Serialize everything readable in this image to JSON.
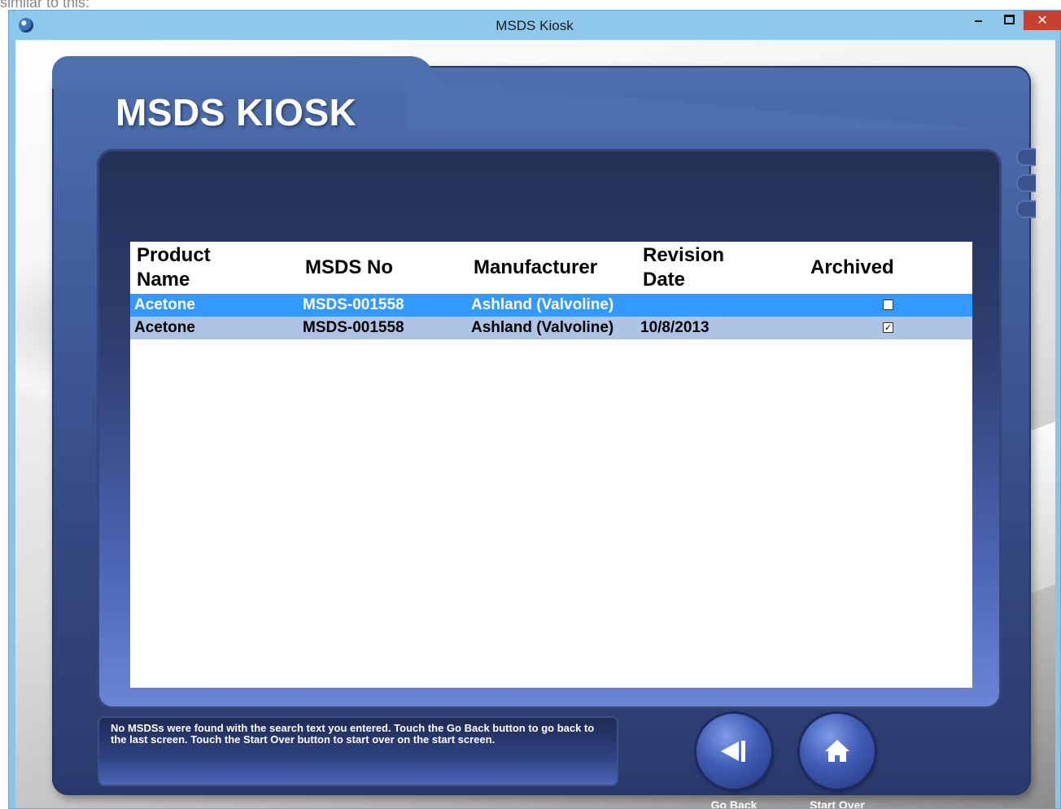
{
  "page_caption": "similar to this:",
  "window": {
    "title": "MSDS Kiosk"
  },
  "brand": "MSDS KIOSK",
  "table": {
    "columns": [
      "Product Name",
      "MSDS No",
      "Manufacturer",
      "Revision Date",
      "Archived"
    ],
    "rows": [
      {
        "product": "Acetone",
        "msds_no": "MSDS-001558",
        "manufacturer": "Ashland (Valvoline)",
        "revision_date": "",
        "archived": false,
        "selected": true
      },
      {
        "product": "Acetone",
        "msds_no": "MSDS-001558",
        "manufacturer": "Ashland (Valvoline)",
        "revision_date": "10/8/2013",
        "archived": true,
        "selected": false
      }
    ]
  },
  "message": "No MSDSs were found with the search text you entered. Touch the Go Back button to go back to the last screen. Touch the Start Over button to start over on the start screen.",
  "buttons": {
    "go_back": "Go Back",
    "start_over": "Start Over"
  },
  "icons": {
    "go_back": "back-arrow-icon",
    "start_over": "home-icon"
  },
  "colors": {
    "titlebar": "#8ec8ea",
    "selected_row": "#3399ff",
    "alt_row": "#aec4e6",
    "close_button": "#c84031"
  }
}
